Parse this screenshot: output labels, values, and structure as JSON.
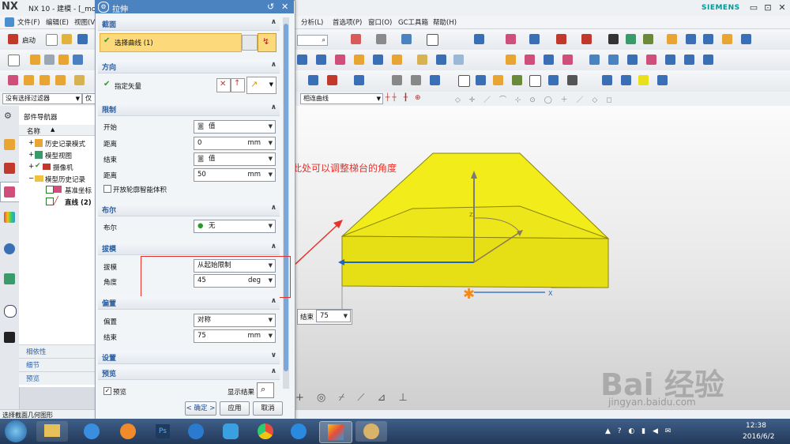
{
  "window": {
    "logo": "NX",
    "title": "NX 10 - 建模 - [_mo",
    "brand": "SIEMENS",
    "minimize": "▭",
    "restore": "⊡",
    "close": "✕"
  },
  "menubar": {
    "left_items": [
      "文件(F)",
      "编辑(E)",
      "视图(V"
    ],
    "right_items": [
      "分析(L)",
      "首选项(P)",
      "窗口(O)",
      "GC工具箱",
      "帮助(H)"
    ]
  },
  "toolbar": {
    "start_label": "启动",
    "filter_value": "没有选择过滤器",
    "filter2_value": "仅",
    "curve_rule_value": "相连曲线"
  },
  "navigator": {
    "title": "部件导航器",
    "col_name": "名称",
    "items": [
      {
        "label": "历史记录模式"
      },
      {
        "label": "模型视图"
      },
      {
        "label": "摄像机"
      },
      {
        "label": "模型历史记录"
      },
      {
        "label": "基准坐标"
      },
      {
        "label": "直线 (2)"
      }
    ],
    "bottom_sections": [
      "相依性",
      "细节",
      "预览"
    ]
  },
  "status": {
    "message": "选择截面几何图形"
  },
  "dialog": {
    "title": "拉伸",
    "sections": {
      "section": {
        "title": "截面",
        "select_curve": "选择曲线 (1)"
      },
      "direction": {
        "title": "方向",
        "specify_vector": "指定矢量"
      },
      "limits": {
        "title": "限制",
        "start_label": "开始",
        "start_value": "值",
        "start_dist_label": "距离",
        "start_dist_value": "0",
        "start_dist_unit": "mm",
        "end_label": "结束",
        "end_value": "值",
        "end_dist_label": "距离",
        "end_dist_value": "50",
        "end_dist_unit": "mm",
        "open_profile": "开放轮廓智能体积"
      },
      "boolean": {
        "title": "布尔",
        "label": "布尔",
        "value": "无"
      },
      "draft": {
        "title": "拔模",
        "draft_label": "拔模",
        "draft_value": "从起始限制",
        "angle_label": "角度",
        "angle_value": "45",
        "angle_unit": "deg"
      },
      "offset": {
        "title": "偏置",
        "offset_label": "偏置",
        "offset_value": "对称",
        "end_label": "结束",
        "end_value": "75",
        "end_unit": "mm"
      },
      "settings": {
        "title": "设置"
      },
      "preview": {
        "title": "预览",
        "preview_label": "预览",
        "show_result": "显示结果"
      }
    },
    "ok": "< 确定 >",
    "apply": "应用",
    "cancel": "取消"
  },
  "graphics": {
    "annotation": "此处可以调整梯台的角度",
    "onscreen_label": "结束",
    "onscreen_value": "75",
    "axis_x_label": "X",
    "axis_z_label": "Z",
    "watermark": "Bai 经验",
    "watermark_url": "jingyan.baidu.com",
    "colors": {
      "solid": "#f2ec1a",
      "edge": "#8a8410",
      "annotation": "#e8312b",
      "axis_x": "#1e63c6"
    }
  },
  "taskbar": {
    "apps": [
      "windows-start",
      "file-explorer",
      "qq-browser",
      "firefox",
      "photoshop",
      "ie",
      "app-store",
      "chrome",
      "doraemon",
      "nx",
      "palette"
    ],
    "time": "12:38",
    "date": "2016/6/2"
  }
}
